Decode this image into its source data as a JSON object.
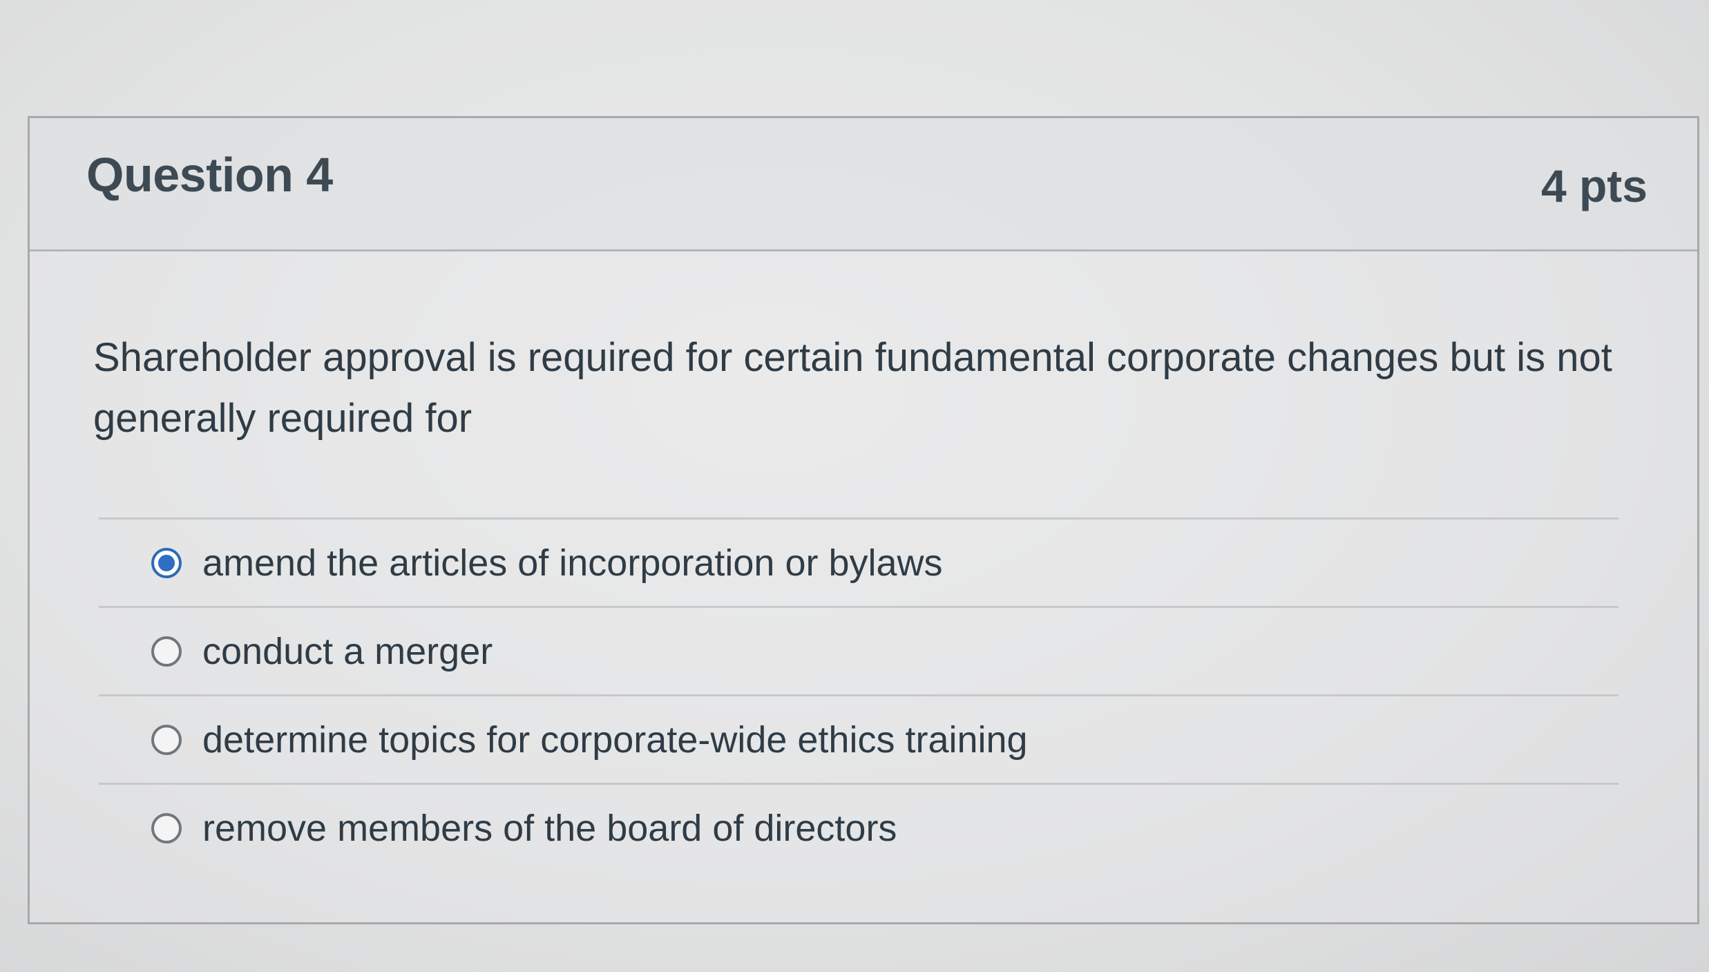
{
  "question": {
    "title": "Question 4",
    "points": "4 pts",
    "text": "Shareholder approval is required for certain fundamental corporate changes but is not generally required for"
  },
  "answers": [
    {
      "label": "amend the articles of incorporation or bylaws",
      "selected": true
    },
    {
      "label": "conduct a merger",
      "selected": false
    },
    {
      "label": "determine topics for corporate-wide ethics training",
      "selected": false
    },
    {
      "label": "remove members of the board of directors",
      "selected": false
    }
  ],
  "colors": {
    "accent": "#2e6fc2",
    "text": "#2f3c46",
    "border": "#a6a9ab"
  }
}
